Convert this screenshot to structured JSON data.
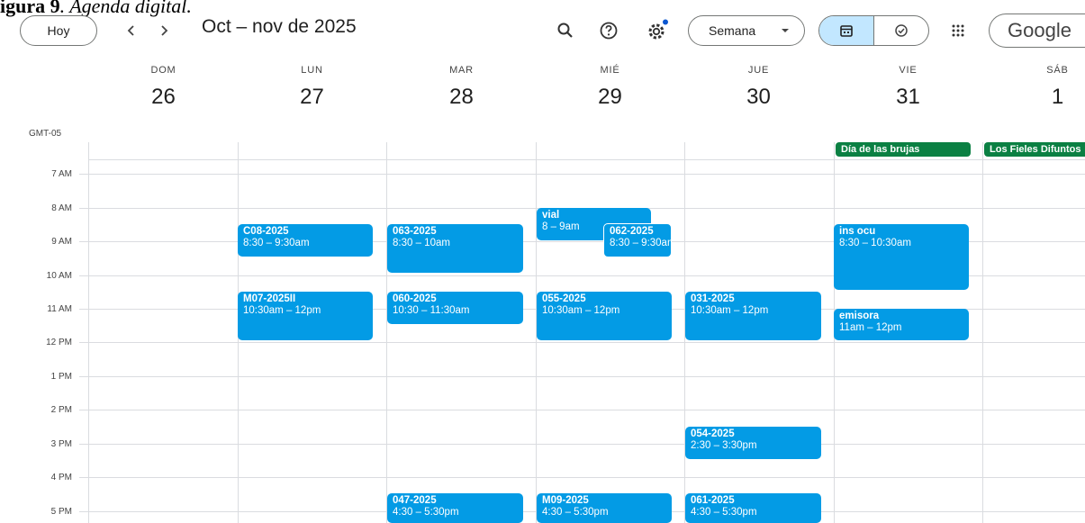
{
  "caption": {
    "bold": "igura 9",
    "italic": ". Agenda digital."
  },
  "header": {
    "today_label": "Hoy",
    "prev_icon": "chevron-left-icon",
    "next_icon": "chevron-right-icon",
    "title": "Oct – nov de 2025",
    "view_label": "Semana",
    "brand": "Google"
  },
  "timezone": "GMT-05",
  "days": [
    {
      "dow": "DOM",
      "num": "26"
    },
    {
      "dow": "LUN",
      "num": "27"
    },
    {
      "dow": "MAR",
      "num": "28"
    },
    {
      "dow": "MIÉ",
      "num": "29"
    },
    {
      "dow": "JUE",
      "num": "30"
    },
    {
      "dow": "VIE",
      "num": "31"
    },
    {
      "dow": "SÁB",
      "num": "1"
    }
  ],
  "hours": [
    "7 AM",
    "8 AM",
    "9 AM",
    "10 AM",
    "11 AM",
    "12 PM",
    "1 PM",
    "2 PM",
    "3 PM",
    "4 PM",
    "5 PM"
  ],
  "all_day": [
    {
      "label": "Día de las brujas",
      "day": "VIE"
    },
    {
      "label": "Los Fieles Difuntos",
      "day": "SÁB"
    }
  ],
  "events": [
    {
      "title": "C08-2025",
      "time": "8:30 – 9:30am",
      "day": "LUN"
    },
    {
      "title": "063-2025",
      "time": "8:30 – 10am",
      "day": "MAR"
    },
    {
      "title": "vial",
      "time": "8 – 9am",
      "day": "MIÉ"
    },
    {
      "title": "062-2025",
      "time": "8:30 – 9:30am",
      "day": "MIÉ"
    },
    {
      "title": "ins ocu",
      "time": "8:30 – 10:30am",
      "day": "VIE"
    },
    {
      "title": "M07-2025II",
      "time": "10:30am – 12pm",
      "day": "LUN"
    },
    {
      "title": "060-2025",
      "time": "10:30 – 11:30am",
      "day": "MAR"
    },
    {
      "title": "055-2025",
      "time": "10:30am – 12pm",
      "day": "MIÉ"
    },
    {
      "title": "031-2025",
      "time": "10:30am – 12pm",
      "day": "JUE"
    },
    {
      "title": "emisora",
      "time": "11am – 12pm",
      "day": "VIE"
    },
    {
      "title": "054-2025",
      "time": "2:30 – 3:30pm",
      "day": "JUE"
    },
    {
      "title": "047-2025",
      "time": "4:30 – 5:30pm",
      "day": "MAR"
    },
    {
      "title": "M09-2025",
      "time": "4:30 – 5:30pm",
      "day": "MIÉ"
    },
    {
      "title": "061-2025",
      "time": "4:30 – 5:30pm",
      "day": "JUE"
    }
  ],
  "colors": {
    "event": "#039be5",
    "holiday": "#0b8043",
    "active_view": "#c2e7ff",
    "notification_dot": "#0b57d0"
  }
}
